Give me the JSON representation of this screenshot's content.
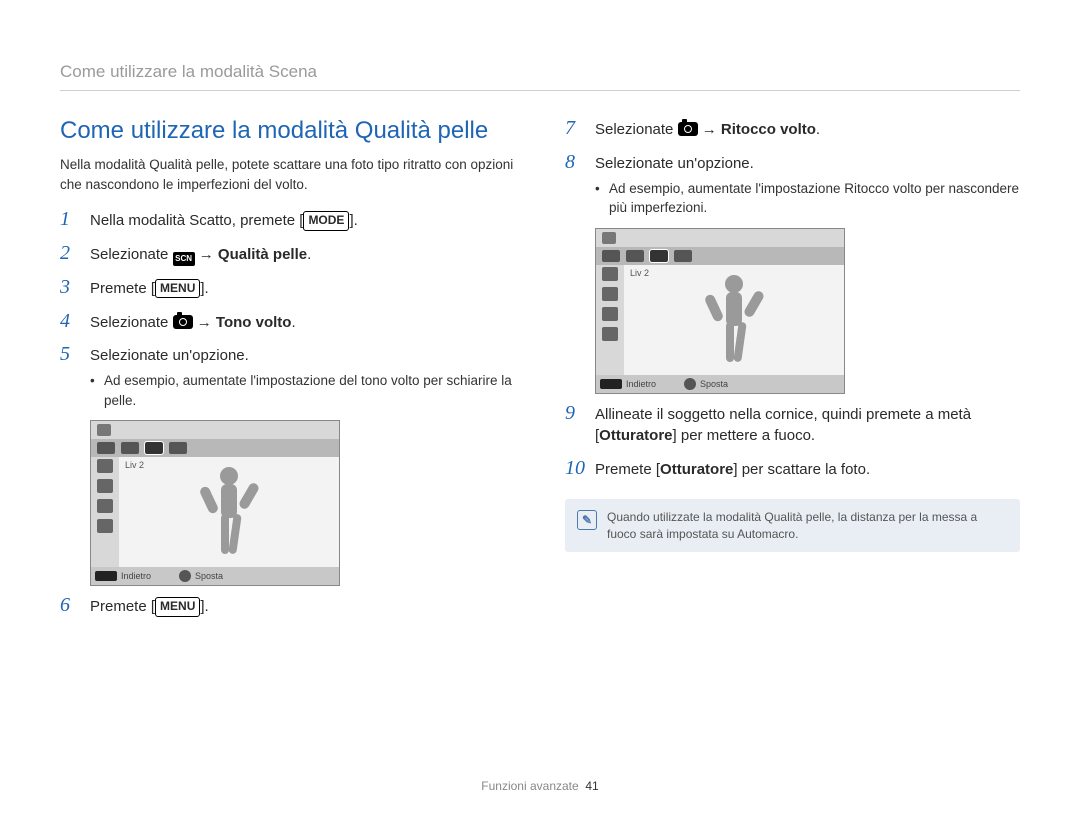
{
  "breadcrumb": "Come utilizzare la modalità Scena",
  "heading": "Come utilizzare la modalità Qualità pelle",
  "intro": "Nella modalità Qualità pelle, potete scattare una foto tipo ritratto con opzioni che nascondono le imperfezioni del volto.",
  "menu_label": "MENU",
  "mode_label": "MODE",
  "scn_label": "SCN",
  "arrow": "→",
  "qualita_pelle": "Qualità pelle",
  "tono_volto": "Tono volto",
  "ritocco_volto": "Ritocco volto",
  "otturatore": "Otturatore",
  "steps_left": {
    "1": "Nella modalità Scatto, premete [",
    "1_end": "].",
    "2a": "Selezionate ",
    "2b": ".",
    "3a": "Premete [",
    "3b": "].",
    "4a": "Selezionate ",
    "4b": ".",
    "5": "Selezionate un'opzione.",
    "5_sub": "Ad esempio, aumentate l'impostazione del tono volto per schiarire la pelle.",
    "6a": "Premete [",
    "6b": "]."
  },
  "steps_right": {
    "7a": "Selezionate ",
    "7b": ".",
    "8": "Selezionate un'opzione.",
    "8_sub": "Ad esempio, aumentate l'impostazione Ritocco volto per nascondere più imperfezioni.",
    "9a": "Allineate il soggetto nella cornice, quindi premete a metà [",
    "9b": "] per mettere a fuoco.",
    "10a": "Premete [",
    "10b": "] per scattare la foto."
  },
  "camera": {
    "level": "Liv 2",
    "back": "Indietro",
    "move": "Sposta"
  },
  "note": "Quando utilizzate la modalità Qualità pelle, la distanza per la messa a fuoco sarà impostata su Automacro.",
  "footer_section": "Funzioni avanzate",
  "page_number": "41"
}
